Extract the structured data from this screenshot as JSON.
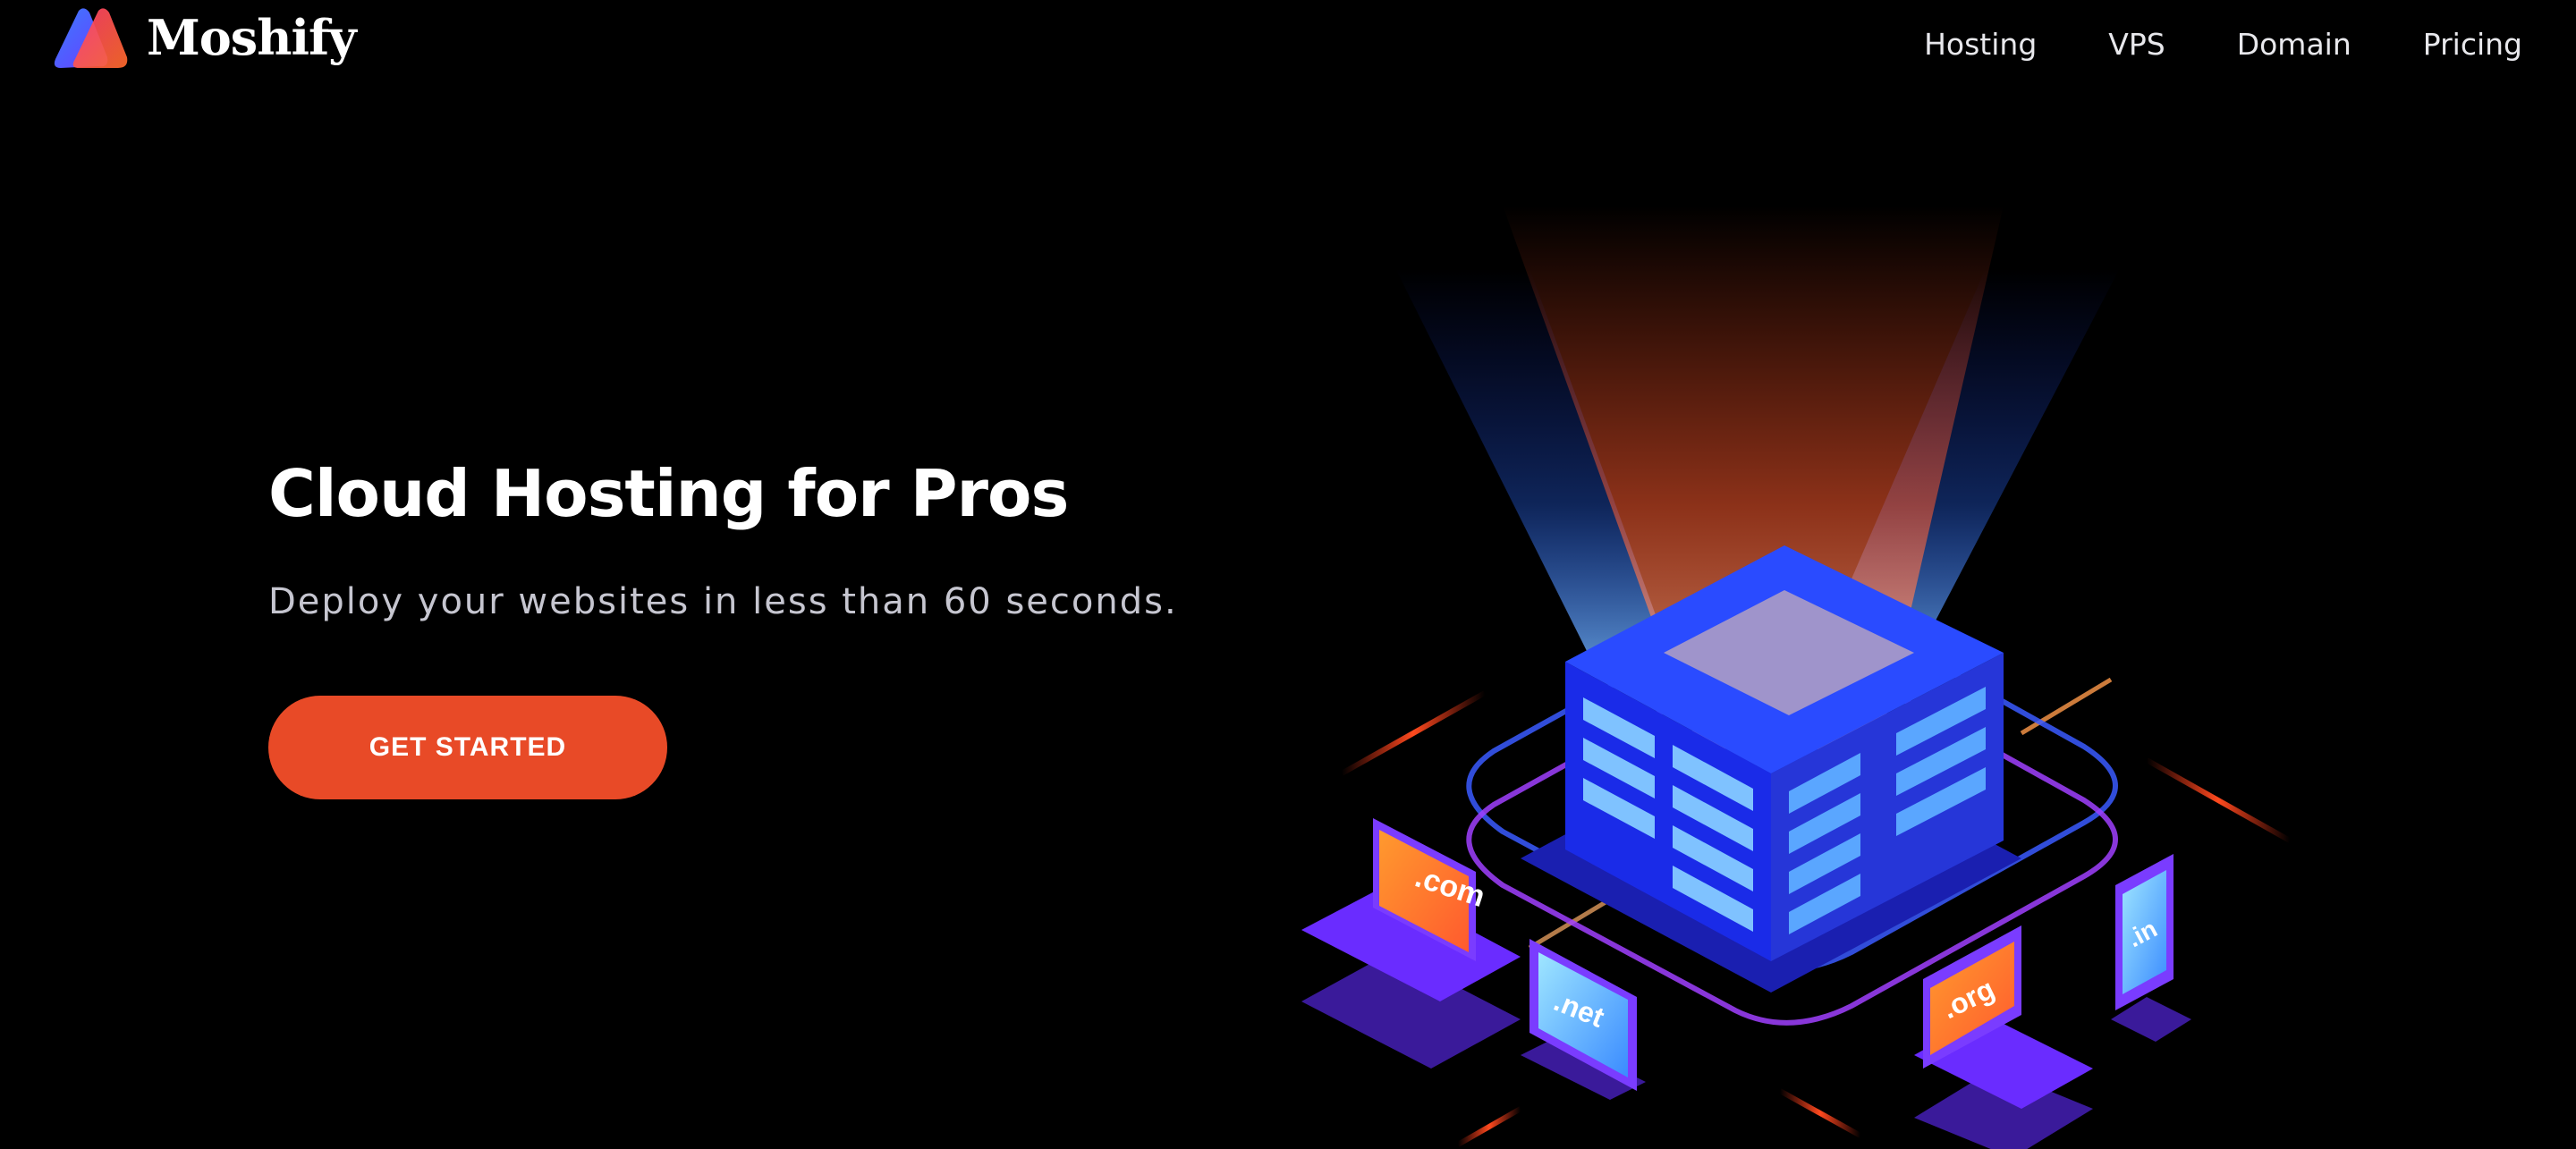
{
  "brand": {
    "name": "Moshify"
  },
  "nav": {
    "items": [
      "Hosting",
      "VPS",
      "Domain",
      "Pricing"
    ]
  },
  "hero": {
    "title": "Cloud Hosting for Pros",
    "subtitle": "Deploy your websites in less than 60 seconds.",
    "cta_label": "GET STARTED"
  },
  "illustration": {
    "domains": [
      ".com",
      ".net",
      ".org",
      ".in"
    ]
  },
  "colors": {
    "background": "#000000",
    "accent": "#e84a27",
    "server_blue": "#1f3cff",
    "glow_orange": "#ff5a2e",
    "device_purple": "#6a2cff"
  }
}
